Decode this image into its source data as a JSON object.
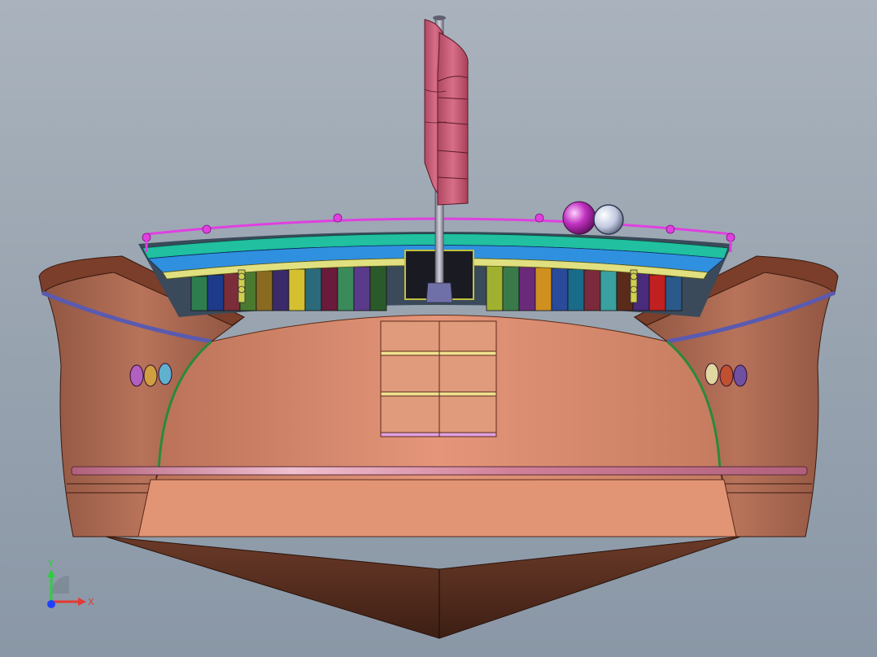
{
  "viewport": {
    "background_top": "#aab3bd",
    "background_bottom": "#8a97a6"
  },
  "model": {
    "hull_color": "#b8735a",
    "deck_color": "#d48b6a",
    "mast_color": "#9a9aa8",
    "sail_color": "#c85a72",
    "railing_color": "#e040e0"
  },
  "triad": {
    "x_label": "X",
    "y_label": "Y",
    "x_color": "#e53935",
    "y_color": "#2ecc40",
    "z_color": "#1e40ff"
  }
}
